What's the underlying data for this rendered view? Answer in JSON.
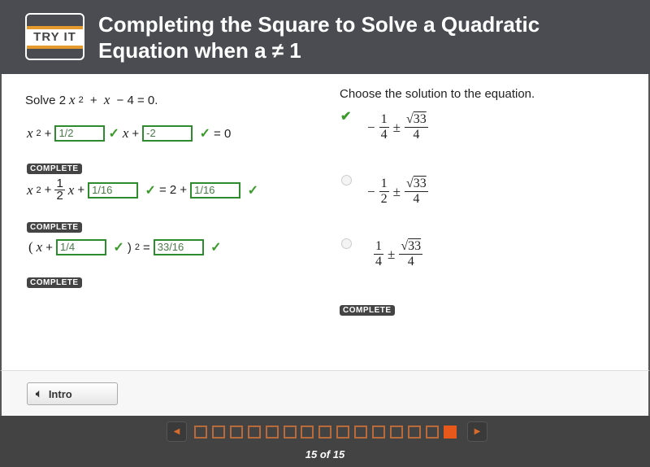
{
  "header": {
    "logo_text": "TRY IT",
    "title_line1": "Completing the Square to Solve a Quadratic",
    "title_line2": "Equation when a ≠ 1"
  },
  "left": {
    "prompt": "Solve 2x² + x − 4 = 0.",
    "step1": {
      "a": "1/2",
      "b": "-2",
      "eq": "= 0"
    },
    "step2": {
      "coef_num": "1",
      "coef_den": "2",
      "a": "1/16",
      "rhs": "= 2 +",
      "b": "1/16"
    },
    "step3": {
      "a": "1/4",
      "eq": "= ",
      "b": "33/16"
    },
    "badge": "COMPLETE"
  },
  "right": {
    "prompt": "Choose the solution to the equation.",
    "options": [
      {
        "sign": "−",
        "num": "1",
        "den": "4",
        "rad": "33",
        "rden": "4",
        "selected": true
      },
      {
        "sign": "−",
        "num": "1",
        "den": "2",
        "rad": "33",
        "rden": "4",
        "selected": false
      },
      {
        "sign": "",
        "num": "1",
        "den": "4",
        "rad": "33",
        "rden": "4",
        "selected": false
      }
    ],
    "badge": "COMPLETE"
  },
  "footer": {
    "intro_label": "Intro"
  },
  "nav": {
    "current": 15,
    "total": 15,
    "count_text": "15 of 15"
  },
  "colors": {
    "header": "#4b4c52",
    "accent": "#e8581a",
    "correct": "#3a9a2a"
  }
}
